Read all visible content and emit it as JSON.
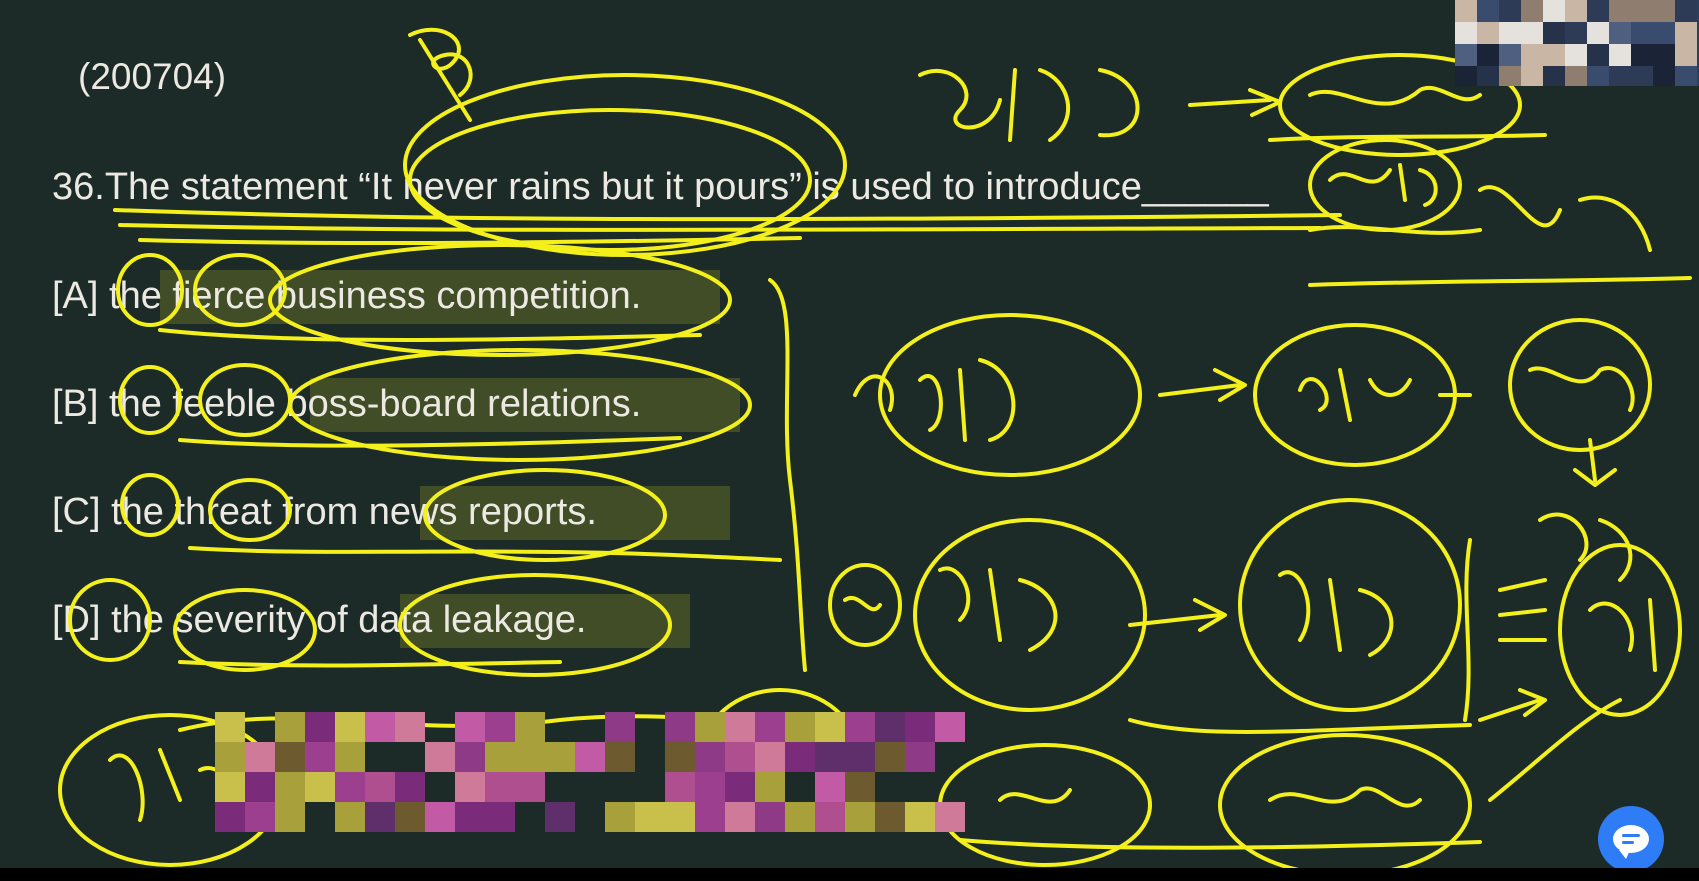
{
  "slide": {
    "exam_code": "(200704)",
    "question": "36.The statement “It never rains but it pours” is used to introduce______",
    "options": [
      "[A] the fierce business competition.",
      "[B] the feeble boss-board relations.",
      "[C] the threat from news reports.",
      "[D] the severity of data leakage."
    ]
  },
  "annotation": {
    "ink_color": "#f4f01c",
    "board_color": "#1d2b28"
  },
  "overlay": {
    "chat_button_icon": "chat-bubble-icon",
    "chat_button_color": "#2f7df6"
  }
}
